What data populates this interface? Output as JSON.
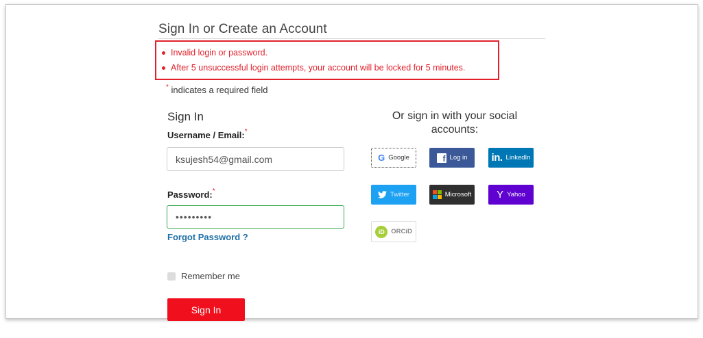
{
  "page": {
    "title": "Sign In or Create an Account",
    "required_note": "indicates a required field",
    "required_marker": "*"
  },
  "errors": [
    "Invalid login or password.",
    "After 5 unsuccessful login attempts, your account will be locked for 5 minutes."
  ],
  "signin": {
    "heading": "Sign In",
    "username_label": "Username / Email:",
    "username_value": "ksujesh54@gmail.com",
    "password_label": "Password:",
    "password_value": "•••••••••",
    "forgot_label": "Forgot Password ?",
    "remember_label": "Remember me",
    "button_label": "Sign In"
  },
  "social": {
    "heading": "Or sign in with your social accounts:",
    "buttons": [
      {
        "label": "Google",
        "icon": "google-icon",
        "color": "#ffffff"
      },
      {
        "label": "Log in",
        "icon": "facebook-icon",
        "color": "#3b5998"
      },
      {
        "label": "LinkedIn",
        "icon": "linkedin-icon",
        "color": "#0077b5"
      },
      {
        "label": "Twitter",
        "icon": "twitter-icon",
        "color": "#1da1f2"
      },
      {
        "label": "Microsoft",
        "icon": "microsoft-icon",
        "color": "#2f2f2f"
      },
      {
        "label": "Yahoo",
        "icon": "yahoo-icon",
        "color": "#5f01d1"
      },
      {
        "label": "ORCiD",
        "icon": "orcid-icon",
        "color": "#a6ce39"
      }
    ]
  },
  "colors": {
    "error": "#e2202c",
    "primary_button": "#f00f1c",
    "link": "#1f6fa6",
    "focus_border": "#35a84b"
  }
}
